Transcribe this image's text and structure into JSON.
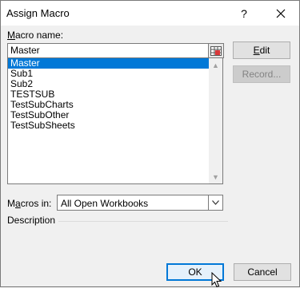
{
  "window": {
    "title": "Assign Macro",
    "help_label": "?"
  },
  "macro_name": {
    "label_prefix": "",
    "label_underline": "M",
    "label_rest": "acro name:",
    "value": "Master"
  },
  "macro_list": {
    "items": [
      "Master",
      "Sub1",
      "Sub2",
      "TESTSUB",
      "TestSubCharts",
      "TestSubOther",
      "TestSubSheets"
    ],
    "selected_index": 0
  },
  "macros_in": {
    "label_prefix": "M",
    "label_underline": "a",
    "label_rest": "cros in:",
    "value": "All Open Workbooks"
  },
  "description": {
    "label": "Description"
  },
  "buttons": {
    "edit_underline": "E",
    "edit_rest": "dit",
    "record_label": "Record...",
    "ok_label": "OK",
    "cancel_label": "Cancel"
  },
  "colors": {
    "selection": "#0078d7",
    "default_button_border": "#0078d7"
  }
}
